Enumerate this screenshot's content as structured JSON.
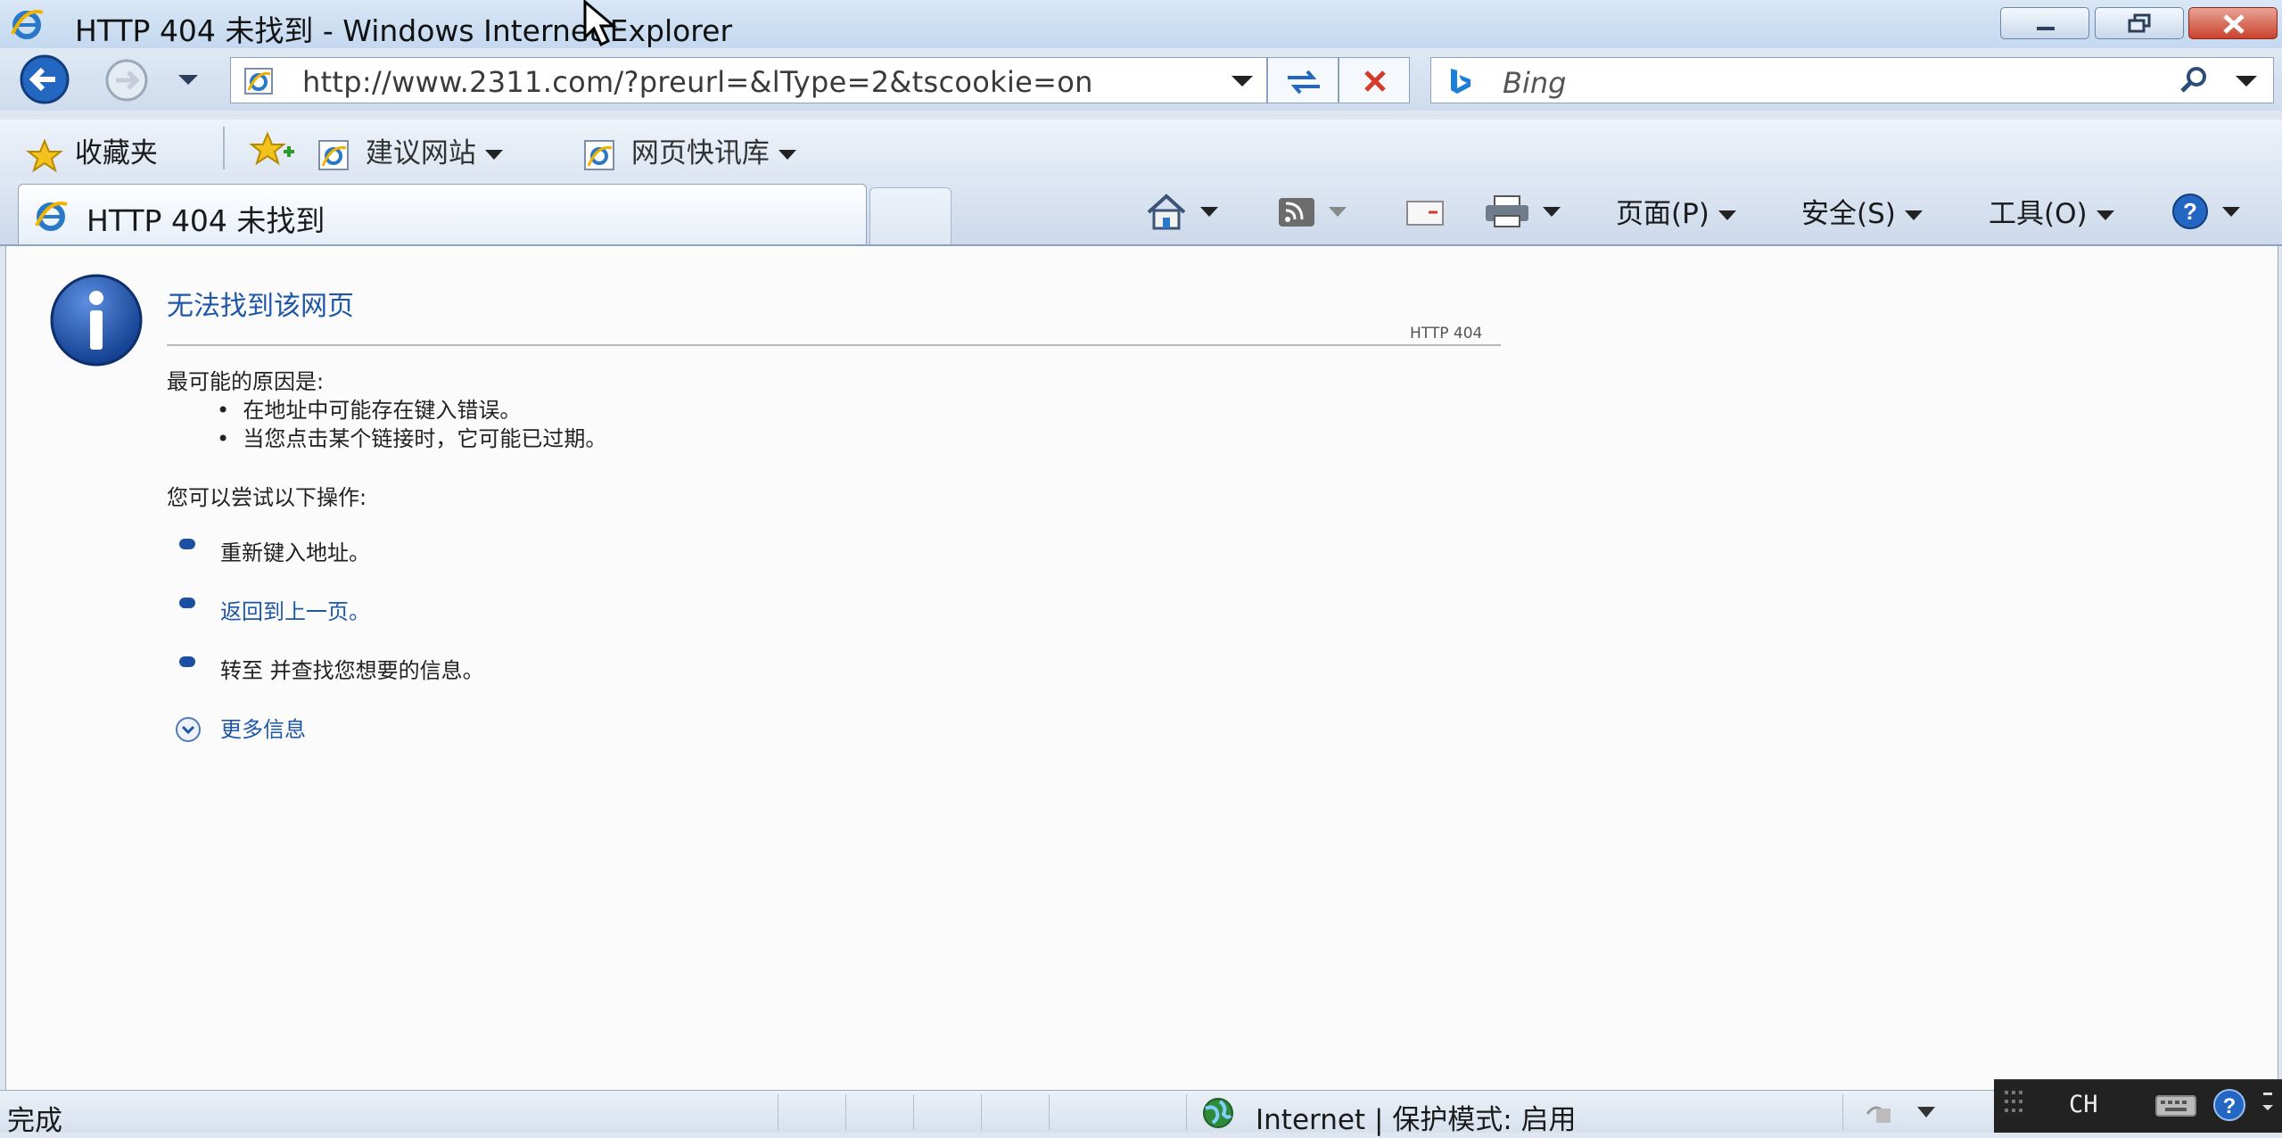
{
  "window": {
    "title": "HTTP 404 未找到 - Windows Internet Explorer"
  },
  "navigation": {
    "address": "http://www.2311.com/?preurl=&lType=2&tscookie=on",
    "search_placeholder": "Bing"
  },
  "favorites_bar": {
    "favorites_label": "收藏夹",
    "items": [
      {
        "label": "建议网站"
      },
      {
        "label": "网页快讯库"
      }
    ]
  },
  "tab": {
    "label": "HTTP 404 未找到"
  },
  "command_bar": {
    "page_menu": "页面(P)",
    "safety_menu": "安全(S)",
    "tools_menu": "工具(O)"
  },
  "page": {
    "title": "无法找到该网页",
    "error_code": "HTTP 404",
    "causes_heading": "最可能的原因是:",
    "causes": [
      "在地址中可能存在键入错误。",
      "当您点击某个链接时，它可能已过期。"
    ],
    "try_heading": "您可以尝试以下操作:",
    "options": [
      "重新键入地址。",
      "返回到上一页。",
      "转至  并查找您想要的信息。"
    ],
    "more_info": "更多信息",
    "colors": {
      "link": "#1f57a8",
      "bullet": "#1c4fa1"
    }
  },
  "status_bar": {
    "status": "完成",
    "zone": "Internet | 保护模式: 启用"
  },
  "taskbar": {
    "language": "CH"
  }
}
